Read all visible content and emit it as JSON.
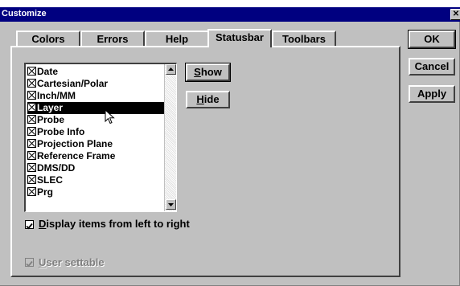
{
  "window": {
    "title": "Customize",
    "close_glyph": "✕"
  },
  "tabs": [
    {
      "label": "Colors",
      "active": false
    },
    {
      "label": "Errors",
      "active": false
    },
    {
      "label": "Help",
      "active": false
    },
    {
      "label": "Statusbar",
      "active": true
    },
    {
      "label": "Toolbars",
      "active": false
    }
  ],
  "statusbar_items": [
    {
      "label": "Date",
      "checked": true,
      "selected": false
    },
    {
      "label": "Cartesian/Polar",
      "checked": true,
      "selected": false
    },
    {
      "label": "Inch/MM",
      "checked": true,
      "selected": false
    },
    {
      "label": "Layer",
      "checked": true,
      "selected": true
    },
    {
      "label": "Probe",
      "checked": true,
      "selected": false
    },
    {
      "label": "Probe Info",
      "checked": true,
      "selected": false
    },
    {
      "label": "Projection Plane",
      "checked": true,
      "selected": false
    },
    {
      "label": "Reference Frame",
      "checked": true,
      "selected": false
    },
    {
      "label": "DMS/DD",
      "checked": true,
      "selected": false
    },
    {
      "label": "SLEC",
      "checked": true,
      "selected": false
    },
    {
      "label": "Prg",
      "checked": true,
      "selected": false
    }
  ],
  "list_buttons": {
    "show": {
      "hotkey": "S",
      "rest": "how"
    },
    "hide": {
      "hotkey": "H",
      "rest": "ide"
    }
  },
  "options": {
    "left_to_right": {
      "hotkey": "D",
      "rest": "isplay items from left to right",
      "checked": true,
      "enabled": true
    },
    "user_settable": {
      "hotkey": "U",
      "rest": "ser settable",
      "checked": true,
      "enabled": false
    }
  },
  "dialog_buttons": {
    "ok": "OK",
    "cancel": "Cancel",
    "apply": "Apply"
  },
  "colors": {
    "titlebar": "#000080",
    "face": "#c0c0c0",
    "selection": "#000000"
  },
  "icons": {
    "cursor": "arrow-pointer-icon",
    "scroll_up": "scroll-up-arrow-icon",
    "scroll_down": "scroll-down-arrow-icon"
  }
}
